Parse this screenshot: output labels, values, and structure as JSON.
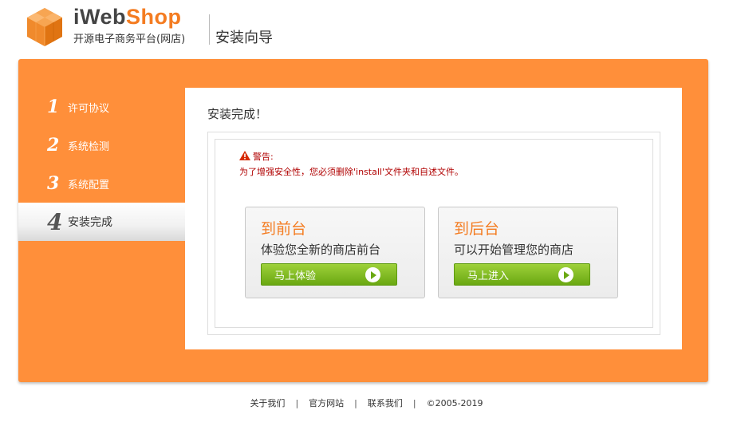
{
  "header": {
    "logo_i": "iWeb",
    "logo_shop": "Shop",
    "subtitle": "开源电子商务平台(网店)",
    "guide_title": "安装向导"
  },
  "steps": [
    {
      "num": "1",
      "label": "许可协议"
    },
    {
      "num": "2",
      "label": "系统检测"
    },
    {
      "num": "3",
      "label": "系统配置"
    },
    {
      "num": "4",
      "label": "安装完成"
    }
  ],
  "main": {
    "title": "安装完成！",
    "warning_title": "警告:",
    "warning_text": "为了增强安全性，您必须删除'install'文件夹和自述文件。",
    "cards": [
      {
        "title": "到前台",
        "desc": "体验您全新的商店前台",
        "button": "马上体验"
      },
      {
        "title": "到后台",
        "desc": "可以开始管理您的商店",
        "button": "马上进入"
      }
    ]
  },
  "footer": {
    "links": [
      "关于我们",
      "官方网站",
      "联系我们"
    ],
    "copyright": "©2005-2019"
  },
  "colors": {
    "brand_orange": "#ff8f3a",
    "button_green": "#7ab51d",
    "warning_red": "#b00000"
  }
}
